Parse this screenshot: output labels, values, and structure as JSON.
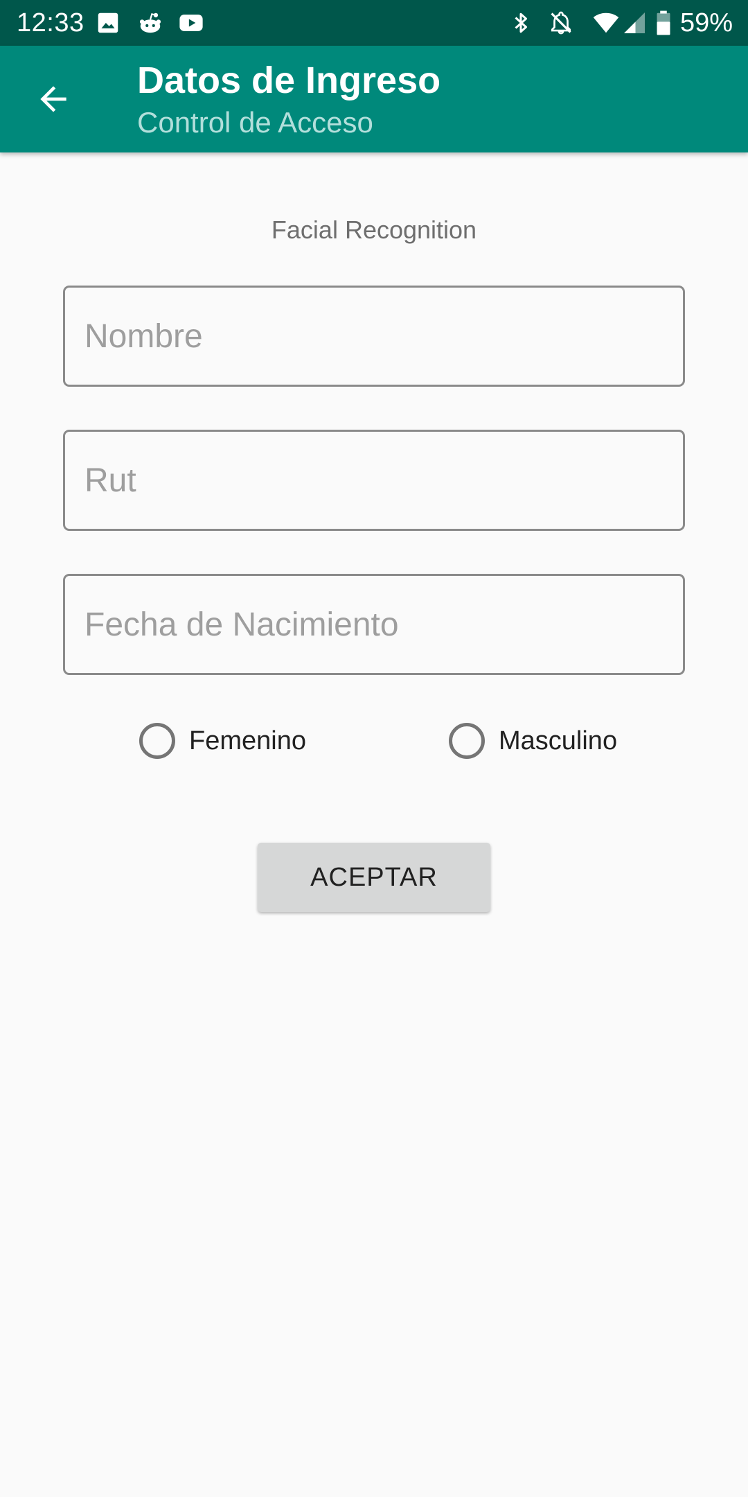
{
  "status_bar": {
    "time": "12:33",
    "battery_percent": "59%",
    "icons": [
      "image-icon",
      "reddit-icon",
      "youtube-icon",
      "bluetooth-icon",
      "notifications-off-icon",
      "wifi-icon",
      "cellular-signal-icon",
      "battery-icon"
    ]
  },
  "app_bar": {
    "back_icon": "arrow-back-icon",
    "title": "Datos de Ingreso",
    "subtitle": "Control de Acceso",
    "color": "#00897b",
    "status_color": "#00574b"
  },
  "form": {
    "section_label": "Facial Recognition",
    "fields": {
      "nombre_placeholder": "Nombre",
      "nombre_value": "",
      "rut_placeholder": "Rut",
      "rut_value": "",
      "fecha_placeholder": "Fecha de Nacimiento",
      "fecha_value": ""
    },
    "gender": {
      "options": [
        {
          "label": "Femenino",
          "checked": false
        },
        {
          "label": "Masculino",
          "checked": false
        }
      ]
    },
    "submit_label": "ACEPTAR"
  }
}
